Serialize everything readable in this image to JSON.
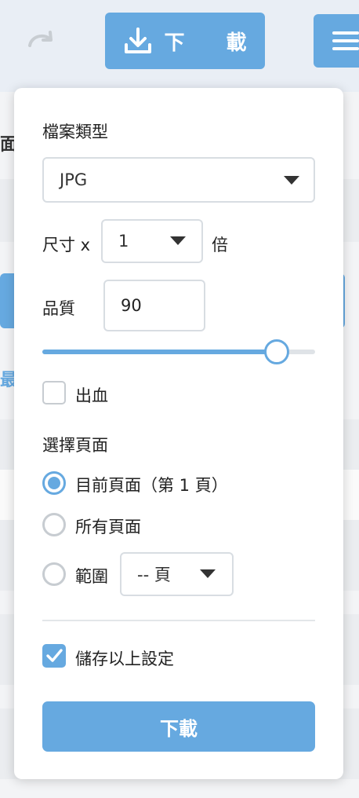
{
  "toolbar": {
    "download_label": "下 載"
  },
  "background": {
    "fragment_1": "面",
    "fragment_2": "最設"
  },
  "panel": {
    "file_type_label": "檔案類型",
    "file_type_value": "JPG",
    "size_prefix": "尺寸 x",
    "size_value": "1",
    "size_suffix": "倍",
    "quality_label": "品質",
    "quality_value": "90",
    "quality_slider_fraction": 0.86,
    "bleed_label": "出血",
    "bleed_checked": false,
    "select_pages_label": "選擇頁面",
    "page_options": [
      {
        "label": "目前頁面（第 1 頁）",
        "selected": true
      },
      {
        "label": "所有頁面",
        "selected": false
      },
      {
        "label": "範圍",
        "selected": false
      }
    ],
    "range_value": "-- 頁",
    "save_settings_label": "儲存以上設定",
    "save_settings_checked": true,
    "submit_label": "下載"
  },
  "colors": {
    "accent": "#66a9e0",
    "border": "#d8dde2"
  }
}
